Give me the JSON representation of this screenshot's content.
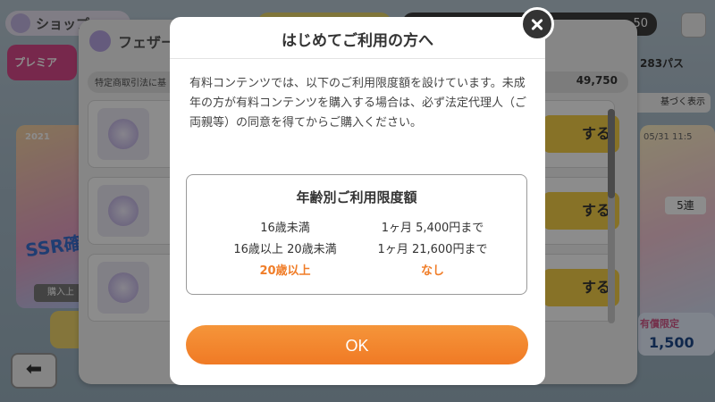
{
  "background": {
    "shop_title": "ショップ",
    "premium_tab": "プレミア",
    "feather_title": "フェザー",
    "law_text": "特定商取引法に基",
    "feather_count": "49,750",
    "pass_count": "283パス",
    "show_label": "基づく表示",
    "coins_visible": "50",
    "buy_label": "する",
    "left_banner_date": "2021",
    "left_banner_text": "SSR確",
    "purchase_label": "購入上",
    "right_banner_date": "05/31 11:5",
    "right_banner_badge": "5連",
    "paid_limited": "有償限定",
    "paid_price": "1,500"
  },
  "modal": {
    "title": "はじめてご利用の方へ",
    "body": "有料コンテンツでは、以下のご利用限度額を設けています。未成年の方が有料コンテンツを購入する場合は、必ず法定代理人（ご両親等）の同意を得てからご購入ください。",
    "limit_heading": "年齢別ご利用限度額",
    "limits": [
      {
        "age": "16歳未満",
        "amount": "1ヶ月 5,400円まで"
      },
      {
        "age": "16歳以上 20歳未満",
        "amount": "1ヶ月 21,600円まで"
      },
      {
        "age": "20歳以上",
        "amount": "なし"
      }
    ],
    "ok_label": "OK"
  },
  "colors": {
    "accent": "#f07d28",
    "ok_button": "#f5953a"
  },
  "icons": {
    "close": "close-icon",
    "back": "back-arrow-icon"
  }
}
